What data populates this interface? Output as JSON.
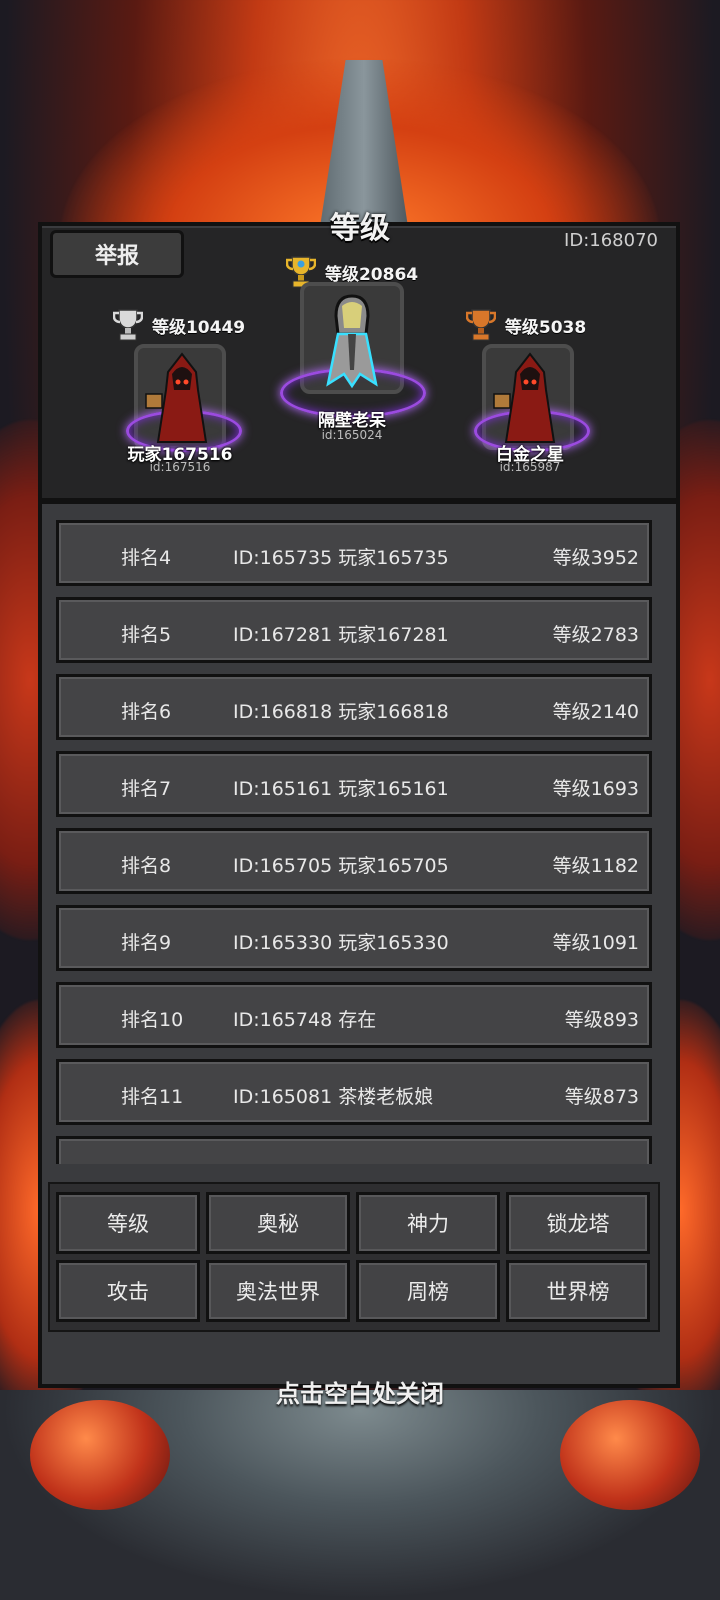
{
  "header": {
    "title": "等级",
    "report_label": "举报",
    "self_id": "ID:168070"
  },
  "top3": [
    {
      "place": 2,
      "level": "等级10449",
      "name": "玩家167516",
      "id": "id:167516",
      "trophy": "silver-trophy-icon"
    },
    {
      "place": 1,
      "level": "等级20864",
      "name": "隔壁老呆",
      "id": "id:165024",
      "trophy": "gold-trophy-icon"
    },
    {
      "place": 3,
      "level": "等级5038",
      "name": "白金之星",
      "id": "id:165987",
      "trophy": "bronze-trophy-icon"
    }
  ],
  "ranking": [
    {
      "rank": "排名4",
      "info": "ID:165735 玩家165735",
      "level": "等级3952"
    },
    {
      "rank": "排名5",
      "info": "ID:167281 玩家167281",
      "level": "等级2783"
    },
    {
      "rank": "排名6",
      "info": "ID:166818 玩家166818",
      "level": "等级2140"
    },
    {
      "rank": "排名7",
      "info": "ID:165161 玩家165161",
      "level": "等级1693"
    },
    {
      "rank": "排名8",
      "info": "ID:165705 玩家165705",
      "level": "等级1182"
    },
    {
      "rank": "排名9",
      "info": "ID:165330 玩家165330",
      "level": "等级1091"
    },
    {
      "rank": "排名10",
      "info": "ID:165748 存在",
      "level": "等级893"
    },
    {
      "rank": "排名11",
      "info": "ID:165081 茶楼老板娘",
      "level": "等级873"
    }
  ],
  "tabs": [
    {
      "label": "等级"
    },
    {
      "label": "奥秘"
    },
    {
      "label": "神力"
    },
    {
      "label": "锁龙塔"
    },
    {
      "label": "攻击"
    },
    {
      "label": "奥法世界"
    },
    {
      "label": "周榜"
    },
    {
      "label": "世界榜"
    }
  ],
  "footer": {
    "close_hint": "点击空白处关闭"
  },
  "colors": {
    "gold": "#e7b52b",
    "silver": "#cfcfcf",
    "bronze": "#d8772a",
    "aura": "#9b4be0"
  }
}
